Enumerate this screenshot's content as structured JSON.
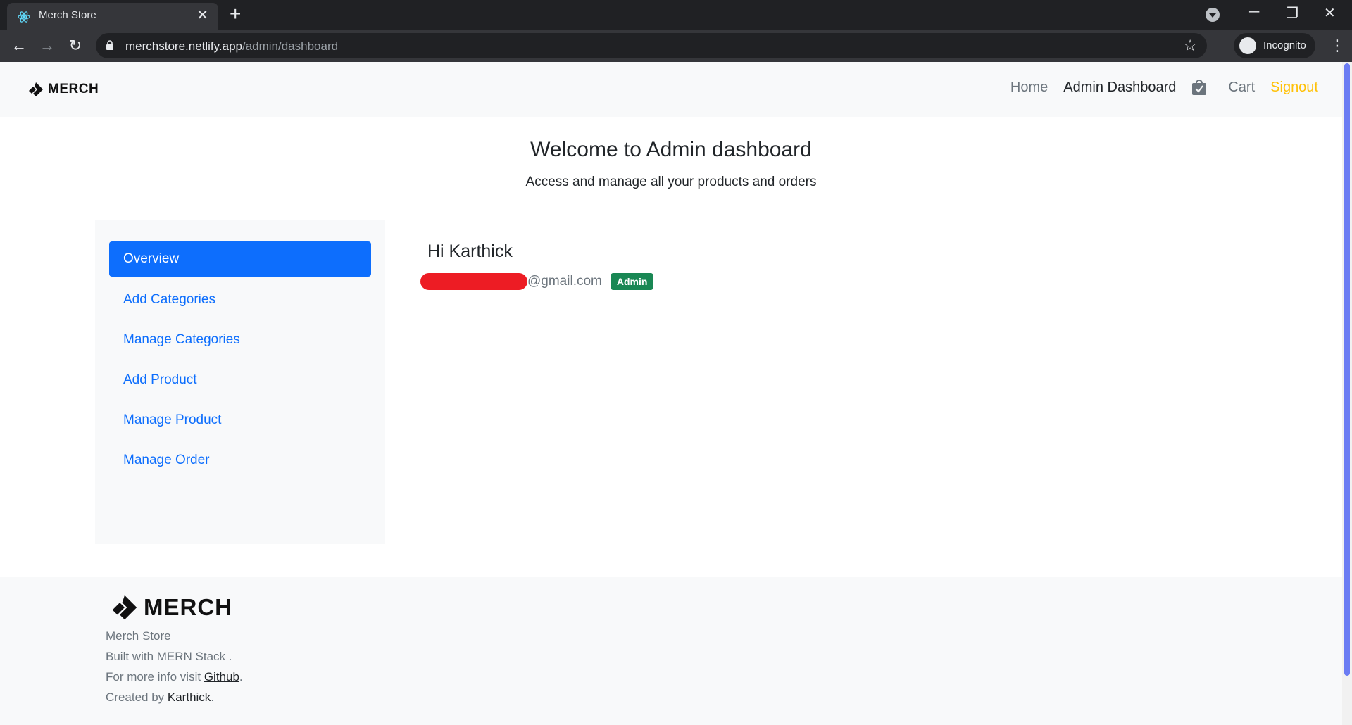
{
  "browser": {
    "tab_title": "Merch Store",
    "url_host": "merchstore.netlify.app",
    "url_path": "/admin/dashboard",
    "profile_label": "Incognito"
  },
  "navbar": {
    "brand": "MERCH",
    "links": {
      "home": "Home",
      "admin_dashboard": "Admin Dashboard",
      "cart": "Cart",
      "signout": "Signout"
    }
  },
  "hero": {
    "title": "Welcome to Admin dashboard",
    "subtitle": "Access and manage all your products and orders"
  },
  "sidebar": {
    "items": [
      {
        "label": "Overview",
        "active": true
      },
      {
        "label": "Add Categories",
        "active": false
      },
      {
        "label": "Manage Categories",
        "active": false
      },
      {
        "label": "Add Product",
        "active": false
      },
      {
        "label": "Manage Product",
        "active": false
      },
      {
        "label": "Manage Order",
        "active": false
      }
    ]
  },
  "profile": {
    "greeting": "Hi Karthick",
    "email_domain": "@gmail.com",
    "role_badge": "Admin"
  },
  "footer": {
    "brand": "MERCH",
    "line1": "Merch Store",
    "line2": "Built with MERN Stack .",
    "line3_prefix": "For more info visit ",
    "line3_link": "Github",
    "line3_suffix": ".",
    "line4_prefix": "Created by ",
    "line4_link": "Karthick",
    "line4_suffix": "."
  },
  "colors": {
    "primary": "#0d6efd",
    "warning": "#ffc107",
    "success": "#198754",
    "light_bg": "#f8f9fa"
  }
}
